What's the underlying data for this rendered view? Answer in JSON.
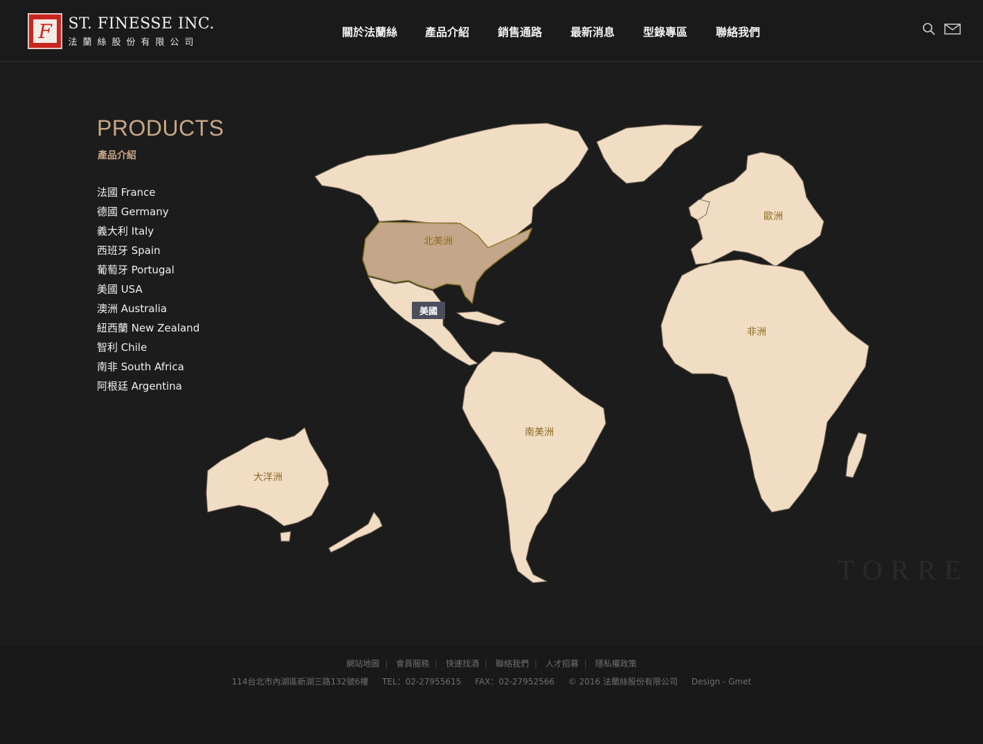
{
  "header": {
    "logo_en": "ST. FINESSE INC.",
    "logo_zh": "法蘭絲股份有限公司",
    "logo_letter": "F",
    "nav": [
      "關於法蘭絲",
      "產品介紹",
      "銷售通路",
      "最新消息",
      "型錄專區",
      "聯絡我們"
    ],
    "icons": [
      "search-icon",
      "mail-icon"
    ]
  },
  "products": {
    "title": "PRODUCTS",
    "subtitle": "產品介紹",
    "countries": [
      "法國 France",
      "德國 Germany",
      "義大利 Italy",
      "西班牙 Spain",
      "葡萄牙 Portugal",
      "美國 USA",
      "澳洲 Australia",
      "紐西蘭 New Zealand",
      "智利 Chile",
      "南非 South Africa",
      "阿根廷 Argentina"
    ]
  },
  "map": {
    "labels": {
      "north_america": "北美洲",
      "europe": "歐洲",
      "africa": "非洲",
      "south_america": "南美洲",
      "oceania": "大洋洲"
    },
    "tooltip": "美國",
    "active_color": "#c4a68a",
    "land_color": "#f1dcc4"
  },
  "watermark": "TORRE",
  "footer": {
    "links": [
      "網站地圖",
      "會員服務",
      "快速找酒",
      "聯絡我們",
      "人才招募",
      "隱私權政策"
    ],
    "address": "114台北市內湖區新湖三路132號6樓",
    "tel": "TEL：02-27955615",
    "fax": "FAX：02-27952566",
    "copyright": "© 2016 法蘭絲股份有限公司",
    "design": "Design - Gmet"
  }
}
